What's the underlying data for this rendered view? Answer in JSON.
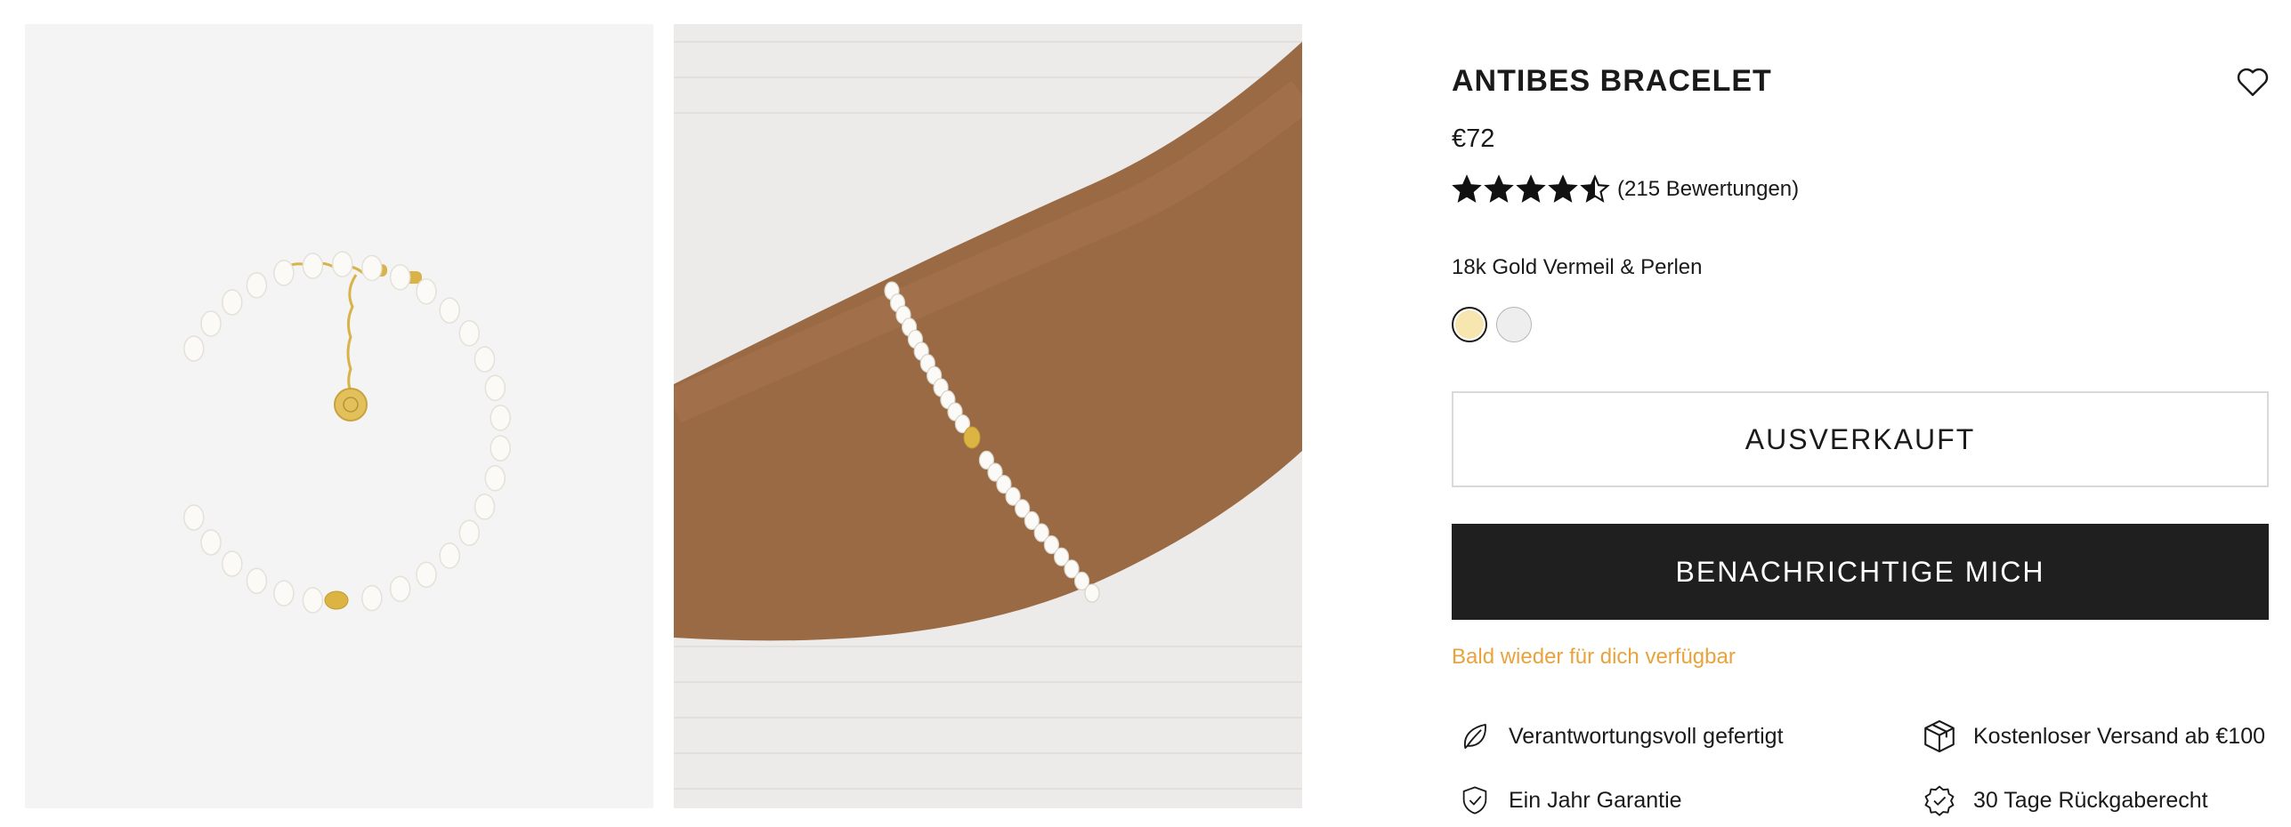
{
  "product": {
    "title": "ANTIBES BRACELET",
    "price": "€72",
    "rating_value": 4.5,
    "rating_max": 5,
    "review_count_text": "(215 Bewertungen)",
    "variant_label": "18k Gold Vermeil & Perlen",
    "variants": [
      {
        "name": "gold",
        "color": "#f7e6b0",
        "selected": true
      },
      {
        "name": "silver",
        "color": "#eeeeee",
        "selected": false
      }
    ]
  },
  "actions": {
    "sold_out_label": "AUSVERKAUFT",
    "notify_label": "BENACHRICHTIGE MICH",
    "restock_note": "Bald wieder für dich verfügbar"
  },
  "features": [
    {
      "icon": "leaf-icon",
      "label": "Verantwortungsvoll gefertigt"
    },
    {
      "icon": "box-icon",
      "label": "Kostenloser Versand ab €100"
    },
    {
      "icon": "shield-check-icon",
      "label": "Ein Jahr Garantie"
    },
    {
      "icon": "badge-check-icon",
      "label": "30 Tage Rückgaberecht"
    }
  ],
  "gallery": {
    "images": [
      {
        "name": "product-image-flatlay"
      },
      {
        "name": "product-image-on-wrist"
      }
    ]
  },
  "colors": {
    "accent_orange": "#e8a33d",
    "button_dark": "#1f1f1f",
    "star": "#111111"
  }
}
